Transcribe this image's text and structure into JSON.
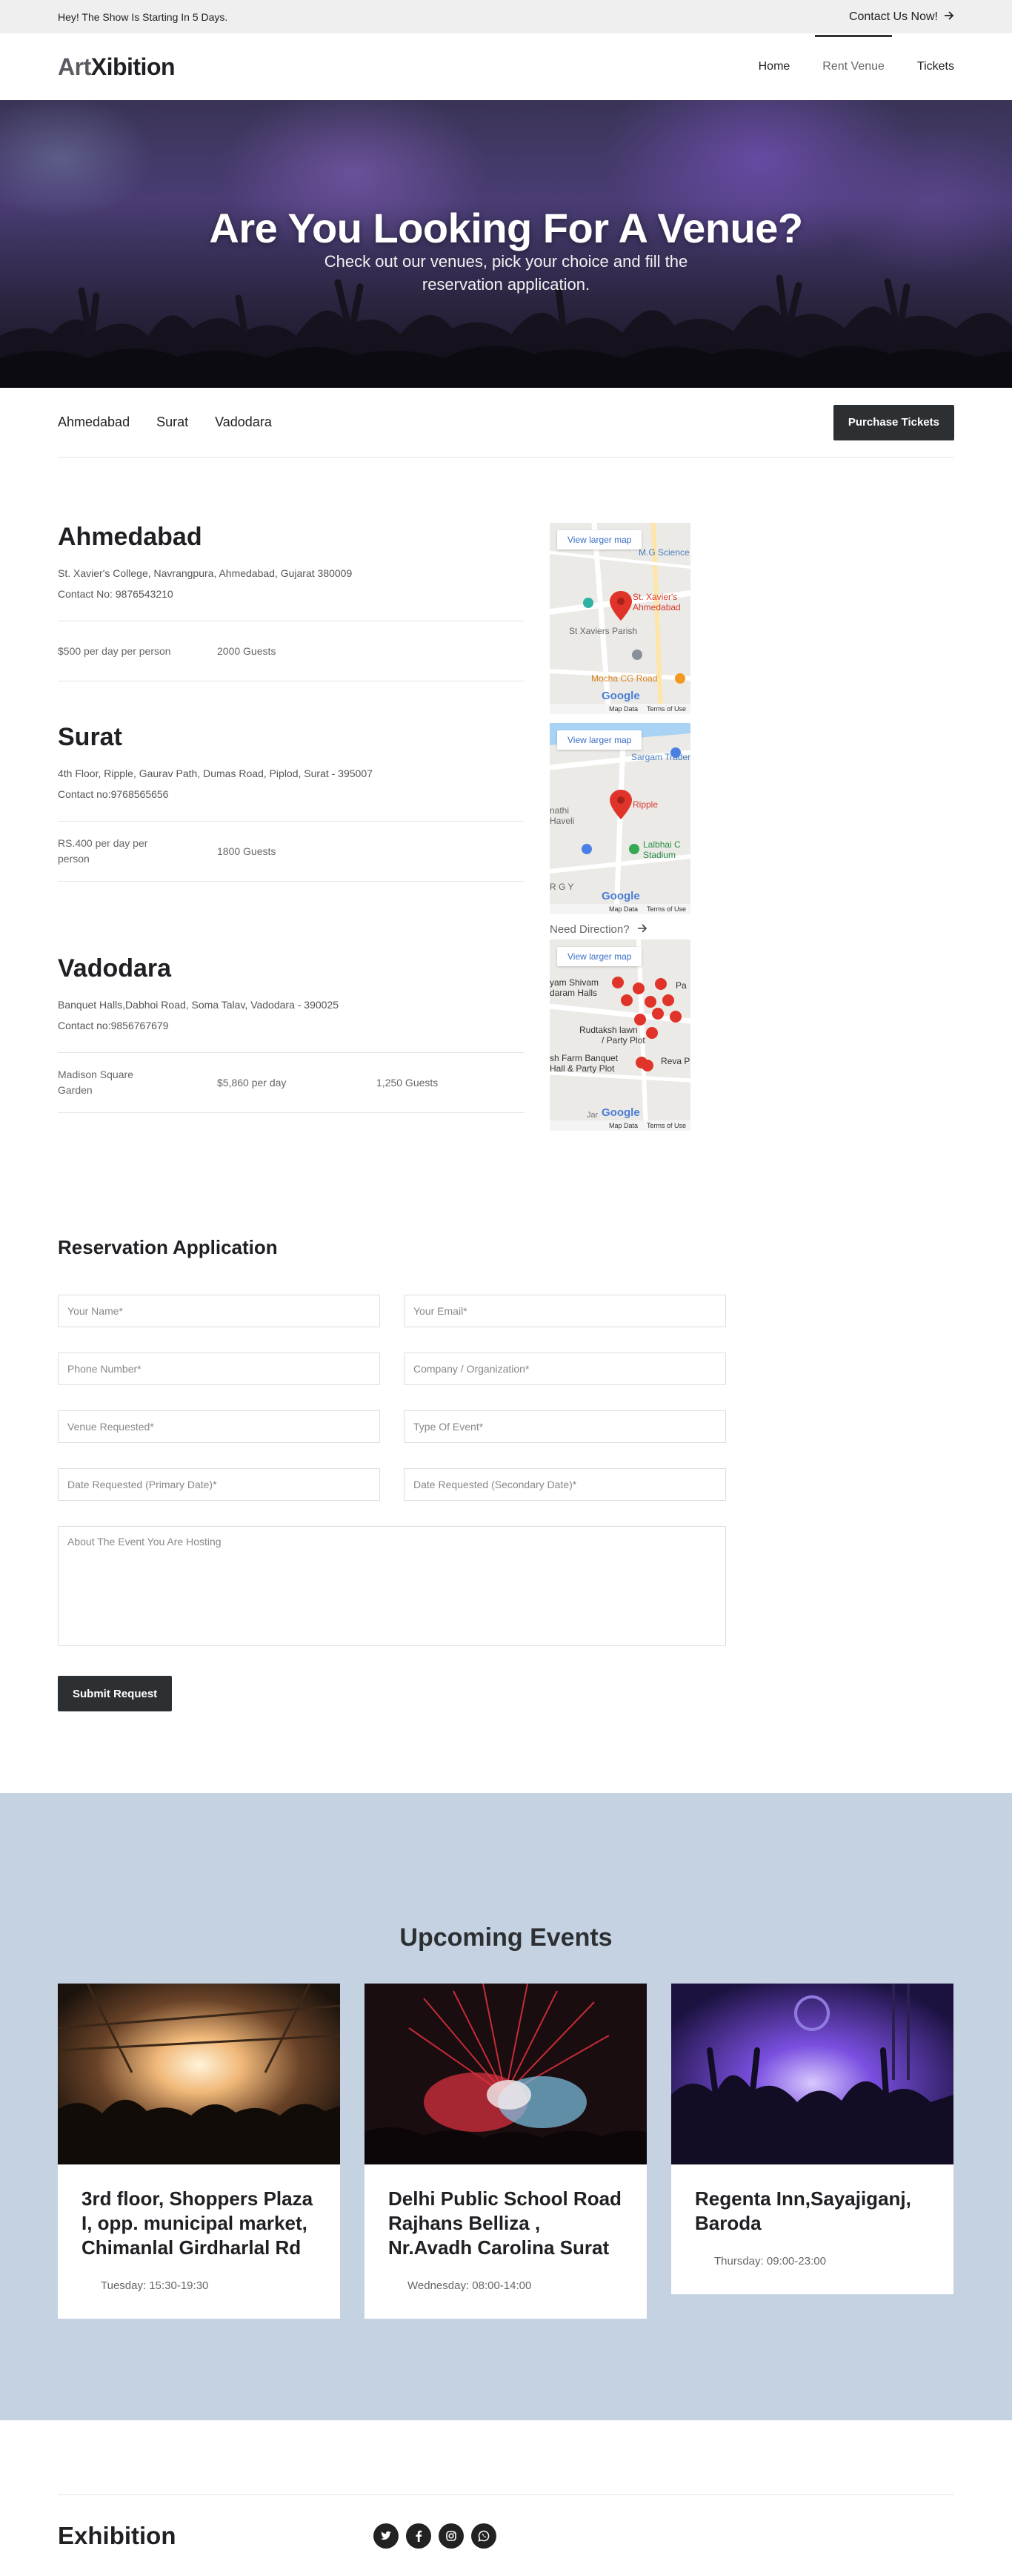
{
  "topbar": {
    "notice": "Hey! The Show Is Starting In 5 Days.",
    "contact": "Contact Us Now!",
    "contact_icon": "arrow-right-icon"
  },
  "header": {
    "logo_part1": "Art",
    "logo_part2": "Xibition",
    "nav": [
      {
        "label": "Home"
      },
      {
        "label": "Rent Venue"
      },
      {
        "label": "Tickets"
      }
    ]
  },
  "hero": {
    "title": "Are You Looking For A Venue?",
    "subtitle_line1": "Check out our venues, pick your choice and fill the",
    "subtitle_line2": "reservation application."
  },
  "venue_tabs": {
    "tabs": [
      "Ahmedabad",
      "Surat",
      "Vadodara"
    ],
    "purchase": "Purchase Tickets"
  },
  "venues": [
    {
      "city": "Ahmedabad",
      "address": "St. Xavier's College, Navrangpura, Ahmedabad, Gujarat 380009",
      "contact": "Contact No: 9876543210",
      "price": "$500 per day per person",
      "guests": "2000 Guests"
    },
    {
      "city": "Surat",
      "address": "4th Floor, Ripple, Gaurav Path, Dumas Road, Piplod, Surat - 395007",
      "contact": "Contact no:9768565656",
      "price": "RS.400 per day per person",
      "guests": "1800 Guests"
    },
    {
      "city": "Vadodara",
      "address": "Banquet Halls,Dabhoi Road, Soma Talav, Vadodara - 390025",
      "contact": "Contact no:9856767679",
      "place": "Madison Square Garden",
      "price": "$5,860 per day",
      "guests": "1,250 Guests"
    }
  ],
  "maps": {
    "larger": "View larger map",
    "map_data": "Map Data",
    "terms": "Terms of Use",
    "google": "Google",
    "need_direction": "Need Direction?",
    "map1": {
      "l1": "M.G Science",
      "l2": "St. Xavier's",
      "l3": "Ahmedabad",
      "l4": "St Xaviers Parish",
      "l5": "Mocha CG Road"
    },
    "map2": {
      "l1": "Sargam Traders",
      "l2": "nathi",
      "l3": "Haveli",
      "l4": "Ripple",
      "l5": "Lalbhai C",
      "l6": "Stadium",
      "l7": "R G Y"
    },
    "map3": {
      "l1": "yam Shivam",
      "l2": "daram Halls",
      "l3": "Rudtaksh lawn",
      "l4": "/ Party Plot",
      "l5": "sh Farm Banquet",
      "l6": "Hall & Party Plot",
      "l7": "Reva P",
      "l8": "Pa",
      "l9": "Jar"
    }
  },
  "reservation": {
    "title": "Reservation Application",
    "fields": {
      "name": "Your Name*",
      "email": "Your Email*",
      "phone": "Phone Number*",
      "company": "Company / Organization*",
      "venue": "Venue Requested*",
      "event_type": "Type Of Event*",
      "date1": "Date Requested (Primary Date)*",
      "date2": "Date Requested (Secondary Date)*",
      "about": "About The Event You Are Hosting"
    },
    "submit": "Submit Request"
  },
  "upcoming": {
    "title": "Upcoming Events",
    "events": [
      {
        "title": "3rd floor, Shoppers Plaza I, opp. municipal market, Chimanlal Girdharlal Rd",
        "time": "Tuesday: 15:30-19:30"
      },
      {
        "title": "Delhi Public School Road Rajhans Belliza , Nr.Avadh Carolina Surat",
        "time": "Wednesday: 08:00-14:00"
      },
      {
        "title": "Regenta Inn,Sayajiganj, Baroda",
        "time": "Thursday: 09:00-23:00"
      }
    ]
  },
  "footer": {
    "title": "Exhibition",
    "socials": [
      "twitter-icon",
      "facebook-icon",
      "instagram-icon",
      "whatsapp-icon"
    ]
  }
}
